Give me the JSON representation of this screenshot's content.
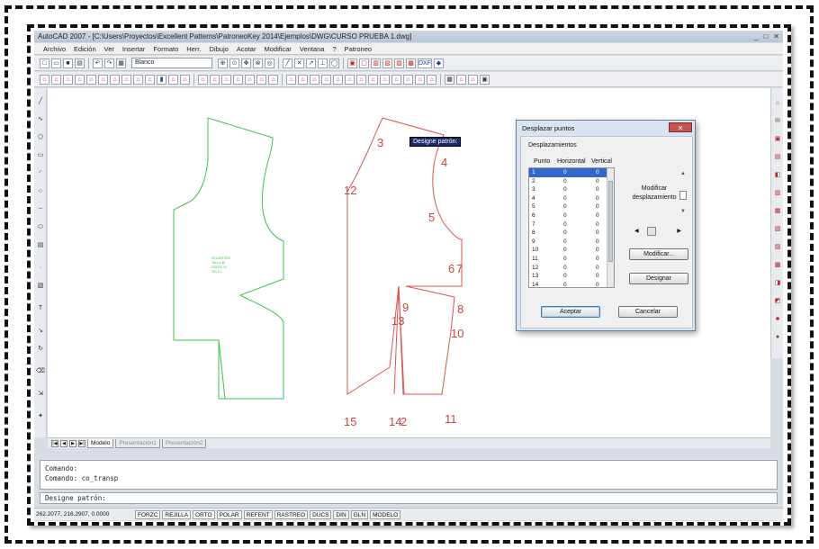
{
  "app": {
    "title": "AutoCAD 2007 - [C:\\Users\\Proyectos\\Excellent Patterns\\PatroneoKey 2014\\Ejemplos\\DWG\\CURSO PRUEBA 1.dwg]",
    "window_controls": [
      "_",
      "□",
      "✕"
    ]
  },
  "menu": [
    "Archivo",
    "Edición",
    "Ver",
    "Insertar",
    "Formato",
    "Herr.",
    "Dibujo",
    "Acotar",
    "Modificar",
    "Ventana",
    "?",
    "Patroneo"
  ],
  "toolbar": {
    "layer_value": "Blanco",
    "extra_label": "DXF"
  },
  "drawing": {
    "green_pattern_text": [
      "DELANTERO",
      "TALLA 38",
      "CORTE X1",
      "TELA 1"
    ],
    "point_labels": [
      "3",
      "4",
      "12",
      "5",
      "6",
      "7",
      "9",
      "8",
      "13",
      "10",
      "15",
      "14",
      "2",
      "11"
    ],
    "tooltip": "Designe patrón:"
  },
  "dialog": {
    "title": "Desplazar puntos",
    "close": "✕",
    "group_label": "Desplazamientos",
    "columns": [
      "Punto",
      "Horizontal",
      "Vertical"
    ],
    "rows": [
      {
        "punto": "1",
        "h": "0",
        "v": "0"
      },
      {
        "punto": "2",
        "h": "0",
        "v": "0"
      },
      {
        "punto": "3",
        "h": "0",
        "v": "0"
      },
      {
        "punto": "4",
        "h": "0",
        "v": "0"
      },
      {
        "punto": "5",
        "h": "0",
        "v": "0"
      },
      {
        "punto": "6",
        "h": "0",
        "v": "0"
      },
      {
        "punto": "7",
        "h": "0",
        "v": "0"
      },
      {
        "punto": "8",
        "h": "0",
        "v": "0"
      },
      {
        "punto": "9",
        "h": "0",
        "v": "0"
      },
      {
        "punto": "10",
        "h": "0",
        "v": "0"
      },
      {
        "punto": "11",
        "h": "0",
        "v": "0"
      },
      {
        "punto": "12",
        "h": "0",
        "v": "0"
      },
      {
        "punto": "13",
        "h": "0",
        "v": "0"
      },
      {
        "punto": "14",
        "h": "0",
        "v": "0"
      }
    ],
    "modify_label_line1": "Modificar",
    "modify_label_line2": "desplazamiento",
    "btn_modificar": "Modificar...",
    "btn_designar": "Designar",
    "btn_aceptar": "Aceptar",
    "btn_cancelar": "Cancelar"
  },
  "tabs": {
    "nav": [
      "|◀",
      "◀",
      "▶",
      "▶|"
    ],
    "items": [
      "Modelo",
      "Presentación1",
      "Presentación2"
    ]
  },
  "command": {
    "line1": "Comando:",
    "line2": "Comando: co_transp",
    "prompt": "Designe patrón:"
  },
  "status": {
    "coords": "262.2077, 216.2907, 0.0000",
    "buttons": [
      "FORZC",
      "REJILLA",
      "ORTO",
      "POLAR",
      "REFENT",
      "RASTREO",
      "DUCS",
      "DIN",
      "GLN",
      "MODELO"
    ]
  },
  "colors": {
    "green_pattern": "#3fc24a",
    "red_pattern": "#d9534f",
    "label_red": "#c9453f"
  }
}
